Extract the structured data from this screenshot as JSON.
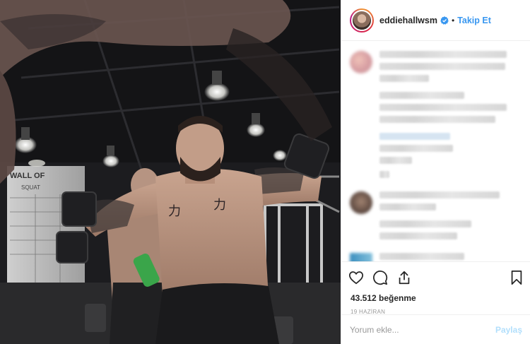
{
  "header": {
    "username": "eddiehallwsm",
    "separator": "•",
    "follow_label": "Takip Et"
  },
  "post": {
    "likes_text": "43.512 beğenme",
    "date_text": "19 HAZİRAN"
  },
  "photo": {
    "wall_sign": "WALL OF",
    "sub_sign": "SQUAT",
    "tattoo_left": "力",
    "tattoo_right": "力"
  },
  "comment_box": {
    "placeholder": "Yorum ekle...",
    "post_label": "Paylaş"
  },
  "colors": {
    "link_blue": "#3897f0",
    "post_disabled": "#b2dffc",
    "border": "#efefef"
  },
  "icons": [
    "heart-icon",
    "comment-icon",
    "share-icon",
    "bookmark-icon",
    "verified-badge-icon"
  ]
}
